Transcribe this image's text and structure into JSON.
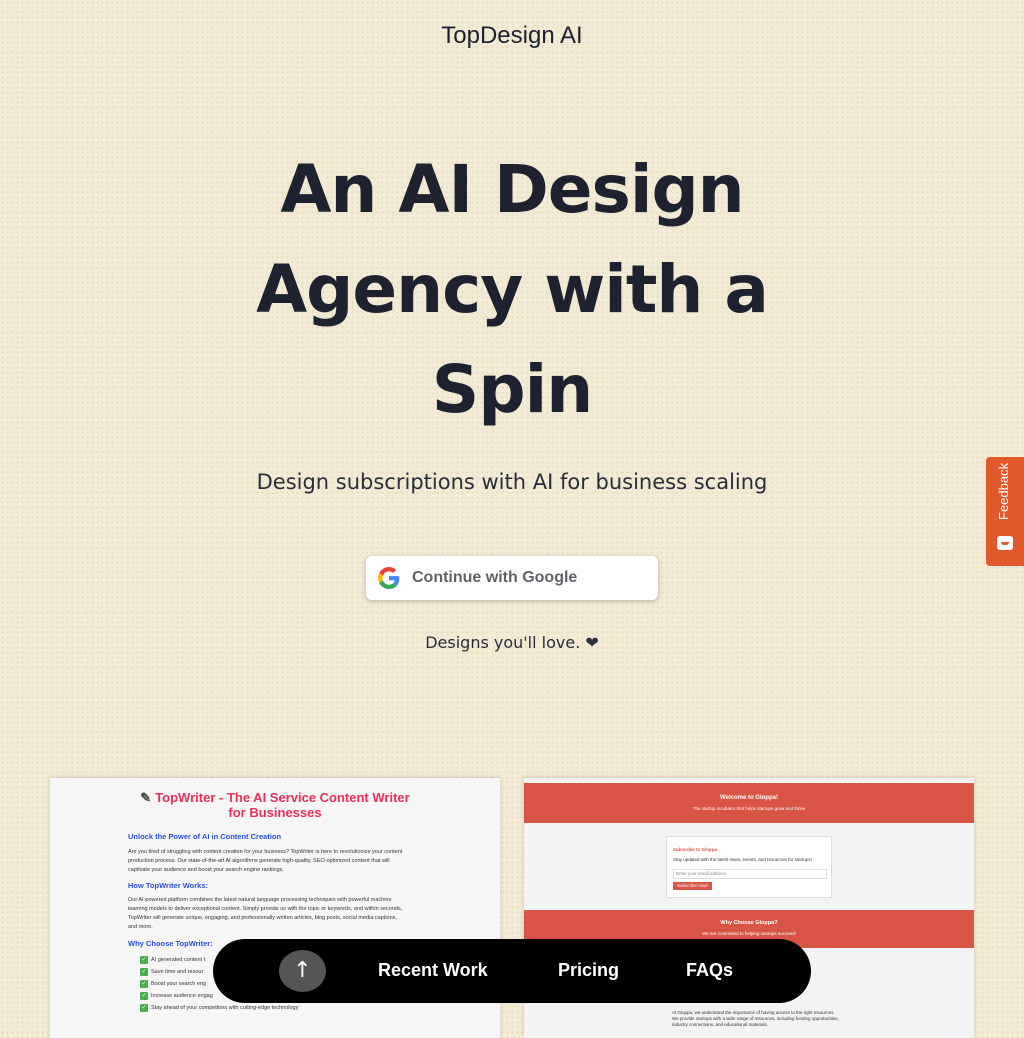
{
  "header": {
    "brand": "TopDesign AI"
  },
  "hero": {
    "title_line1": "An AI Design",
    "title_line2": "Agency with a",
    "title_line3": "Spin",
    "subtitle": "Design subscriptions with AI for business scaling",
    "google_button_label": "Continue with Google",
    "tagline": "Designs you'll love. ❤"
  },
  "feedback_tab": {
    "label": "Feedback"
  },
  "portfolio": {
    "topwriter": {
      "title_line1": "TopWriter - The AI Service Content Writer",
      "title_line2": "for Businesses",
      "h1": "Unlock the Power of AI in Content Creation",
      "p1a": "Are you tired of struggling with content creation for your business? TopWriter is here to revolutionize your content",
      "p1b": "production process. Our state-of-the-art AI algorithms generate high-quality, SEO-optimized content that will",
      "p1c": "captivate your audience and boost your search engine rankings.",
      "h2": "How TopWriter Works:",
      "p2a": "Our AI-powered platform combines the latest natural language processing techniques with powerful machine",
      "p2b": "learning models to deliver exceptional content. Simply provide us with the topic or keywords, and within seconds,",
      "p2c": "TopWriter will generate unique, engaging, and professionally written articles, blog posts, social media captions,",
      "p2d": "and more.",
      "h3": "Why Choose TopWriter:",
      "li1": "AI generated content t",
      "li2": "Save time and resour",
      "li3": "Boost your search eng",
      "li4": "Increase audience engag",
      "li5": "Stay ahead of your competitors with cutting-edge technology"
    },
    "gloppa": {
      "welcome": "Welcome to Gloppa!",
      "welcome_sub": "The startup incubator that helps startups grow and thrive",
      "subscribe_title": "Subscribe to Gloppa",
      "subscribe_text": "Stay updated with the latest news, events, and resources for startups!",
      "email_placeholder": "Enter your email address",
      "subscribe_button": "Subscribe now!",
      "why_title": "Why Choose Gloppa?",
      "why_sub": "We are committed to helping startups succeed!",
      "body_a": "At Gloppa, we understand the importance of having access to the right resources.",
      "body_b": "We provide startups with a wide range of resources, including funding opportunities,",
      "body_c": "industry connections, and educational materials."
    }
  },
  "bottom_nav": {
    "up_icon": "arrow-up-icon",
    "items": [
      "Recent Work",
      "Pricing",
      "FAQs"
    ]
  }
}
